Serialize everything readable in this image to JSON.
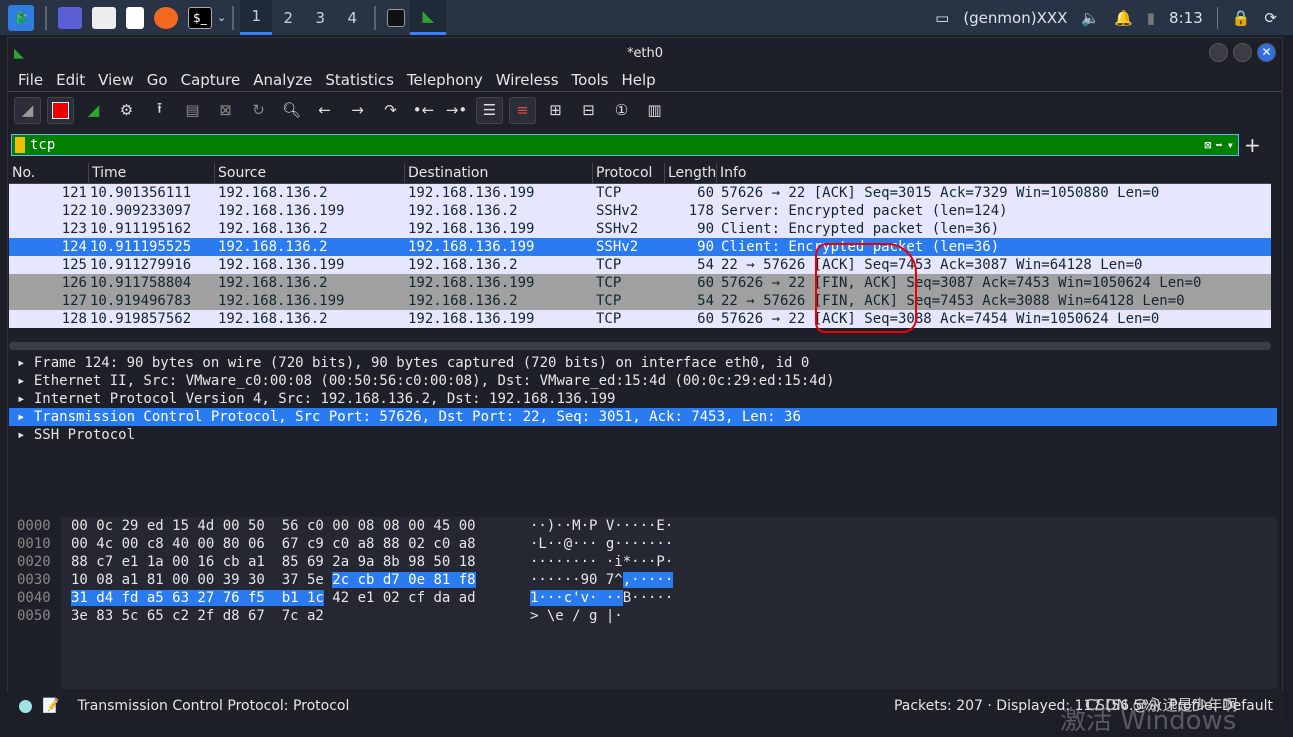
{
  "taskbar": {
    "workspaces": [
      "1",
      "2",
      "3",
      "4"
    ],
    "tray": {
      "genmon": "(genmon)XXX",
      "clock": "8:13"
    }
  },
  "window": {
    "title": "*eth0"
  },
  "menu": [
    "File",
    "Edit",
    "View",
    "Go",
    "Capture",
    "Analyze",
    "Statistics",
    "Telephony",
    "Wireless",
    "Tools",
    "Help"
  ],
  "filter": {
    "value": "tcp"
  },
  "columns": [
    "No.",
    "Time",
    "Source",
    "Destination",
    "Protocol",
    "Length",
    "Info"
  ],
  "packets": [
    {
      "no": "121",
      "time": "10.901356111",
      "src": "192.168.136.2",
      "dst": "192.168.136.199",
      "proto": "TCP",
      "len": "60",
      "info": "57626 → 22 [ACK] Seq=3015 Ack=7329 Win=1050880 Len=0",
      "style": "normal"
    },
    {
      "no": "122",
      "time": "10.909233097",
      "src": "192.168.136.199",
      "dst": "192.168.136.2",
      "proto": "SSHv2",
      "len": "178",
      "info": "Server: Encrypted packet (len=124)",
      "style": "normal"
    },
    {
      "no": "123",
      "time": "10.911195162",
      "src": "192.168.136.2",
      "dst": "192.168.136.199",
      "proto": "SSHv2",
      "len": "90",
      "info": "Client: Encrypted packet (len=36)",
      "style": "normal"
    },
    {
      "no": "124",
      "time": "10.911195525",
      "src": "192.168.136.2",
      "dst": "192.168.136.199",
      "proto": "SSHv2",
      "len": "90",
      "info": "Client: Encrypted packet (len=36)",
      "style": "selected"
    },
    {
      "no": "125",
      "time": "10.911279916",
      "src": "192.168.136.199",
      "dst": "192.168.136.2",
      "proto": "TCP",
      "len": "54",
      "info": "22 → 57626 [ACK] Seq=7453 Ack=3087 Win=64128 Len=0",
      "style": "normal"
    },
    {
      "no": "126",
      "time": "10.911758804",
      "src": "192.168.136.2",
      "dst": "192.168.136.199",
      "proto": "TCP",
      "len": "60",
      "info": "57626 → 22 [FIN, ACK] Seq=3087 Ack=7453 Win=1050624 Len=0",
      "style": "gray"
    },
    {
      "no": "127",
      "time": "10.919496783",
      "src": "192.168.136.199",
      "dst": "192.168.136.2",
      "proto": "TCP",
      "len": "54",
      "info": "22 → 57626 [FIN, ACK] Seq=7453 Ack=3088 Win=64128 Len=0",
      "style": "gray"
    },
    {
      "no": "128",
      "time": "10.919857562",
      "src": "192.168.136.2",
      "dst": "192.168.136.199",
      "proto": "TCP",
      "len": "60",
      "info": "57626 → 22 [ACK] Seq=3088 Ack=7454 Win=1050624 Len=0",
      "style": "normal"
    }
  ],
  "details": [
    "Frame 124: 90 bytes on wire (720 bits), 90 bytes captured (720 bits) on interface eth0, id 0",
    "Ethernet II, Src: VMware_c0:00:08 (00:50:56:c0:00:08), Dst: VMware_ed:15:4d (00:0c:29:ed:15:4d)",
    "Internet Protocol Version 4, Src: 192.168.136.2, Dst: 192.168.136.199",
    "Transmission Control Protocol, Src Port: 57626, Dst Port: 22, Seq: 3051, Ack: 7453, Len: 36",
    "SSH Protocol"
  ],
  "bytes": {
    "offsets": [
      "0000",
      "0010",
      "0020",
      "0030",
      "0040",
      "0050"
    ],
    "hex": [
      [
        "00 0c 29 ed 15 4d 00 50  56 c0 00 08 08 00 45 00",
        "",
        ""
      ],
      [
        "00 4c 00 c8 40 00 80 06  67 c9 c0 a8 88 02 c0 a8",
        "",
        ""
      ],
      [
        "88 c7 e1 1a 00 16 cb a1  85 69 2a 9a 8b 98 50 18",
        "",
        ""
      ],
      [
        "10 08 a1 81 00 00 39 30  37 5e ",
        "2c cb d7 0e 81 f8",
        ""
      ],
      [
        "",
        "31 d4 fd a5 63 27 76 f5  b1 1c",
        " 42 e1 02 cf da ad"
      ],
      [
        "3e 83 5c 65 c2 2f d8 67  7c a2",
        "",
        ""
      ]
    ],
    "ascii": [
      [
        "··)··M·P V·····E·",
        "",
        ""
      ],
      [
        "·L··@··· g·······",
        "",
        ""
      ],
      [
        "········ ·i*···P·",
        "",
        ""
      ],
      [
        "······90 7^",
        ",·····",
        ""
      ],
      [
        "",
        "1···c'v· ··",
        "B·····"
      ],
      [
        "> \\e / g |·",
        "",
        ""
      ]
    ]
  },
  "status": {
    "field": "Transmission Control Protocol: Protocol",
    "packets": "Packets: 207 · Displayed: 117 (56.5%)",
    "profile": "Profile: Default",
    "watermark": "CSDN @永远是少年啊",
    "activate": "激活 Windows"
  }
}
